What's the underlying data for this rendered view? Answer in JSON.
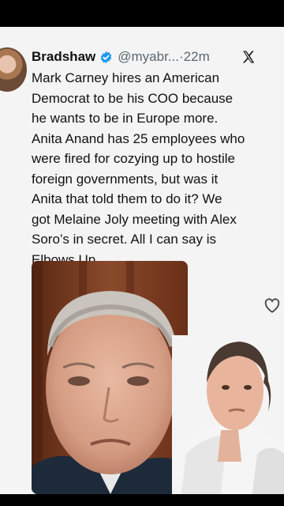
{
  "tweet": {
    "author_name": "Bradshaw",
    "handle": "@myabr...",
    "separator": "·",
    "time": "22m",
    "text": "Mark Carney hires an American\nDemocrat to be his COO because\nhe wants to be in Europe more.\nAnita Anand has 25 employees who\nwere fired for cozying up to hostile\nforeign governments, but was it\nAnita that told them to do it? We\ngot Melaine Joly meeting with Alex\nSoro’s in secret. All I can say is\nElbows Up..."
  },
  "icons": {
    "verified": "verified-badge-icon",
    "x_logo": "x-logo-icon",
    "like": "heart-outline-icon"
  },
  "colors": {
    "card_background": "#f4f4f4",
    "verified_blue": "#1d9bf0",
    "handle_gray": "#5b6770",
    "text": "#111111"
  }
}
